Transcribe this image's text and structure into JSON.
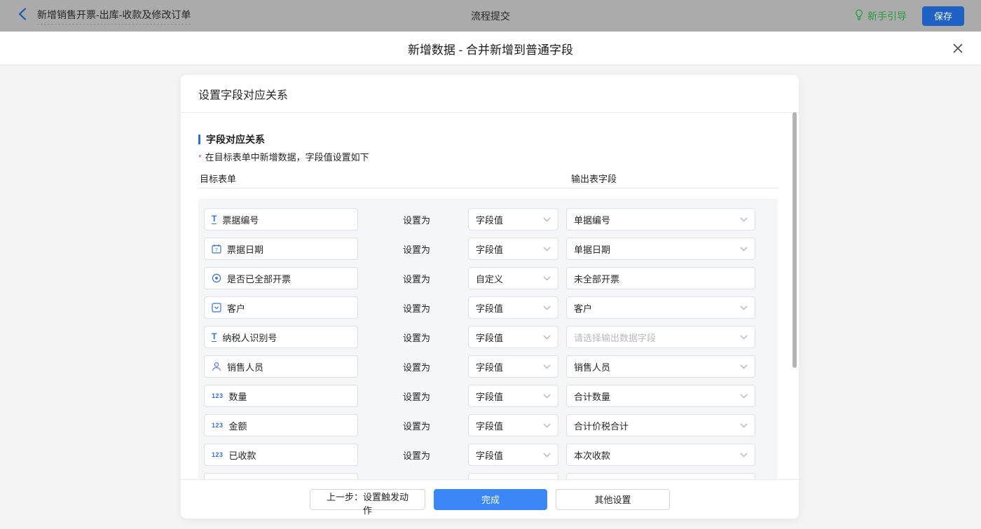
{
  "topbar": {
    "flow_title": "新增销售开票-出库-收款及修改订单",
    "center_title": "流程提交",
    "guide_label": "新手引导",
    "save_label": "保存"
  },
  "modal": {
    "title": "新增数据 - 合并新增到普通字段"
  },
  "panel": {
    "header": "设置字段对应关系",
    "section_title": "字段对应关系",
    "required_mark": "*",
    "hint": "在目标表单中新增数据，字段值设置如下",
    "col_left": "目标表单",
    "col_right": "输出表字段",
    "set_as_label": "设置为"
  },
  "rows": [
    {
      "icon": "text",
      "field": "票据编号",
      "mode": "字段值",
      "output_type": "select",
      "output": "单据编号"
    },
    {
      "icon": "date",
      "field": "票据日期",
      "mode": "字段值",
      "output_type": "select",
      "output": "单据日期"
    },
    {
      "icon": "radio",
      "field": "是否已全部开票",
      "mode": "自定义",
      "output_type": "text",
      "output": "未全部开票"
    },
    {
      "icon": "select",
      "field": "客户",
      "mode": "字段值",
      "output_type": "select",
      "output": "客户"
    },
    {
      "icon": "text",
      "field": "纳税人识别号",
      "mode": "字段值",
      "output_type": "select",
      "output": "",
      "placeholder": "请选择输出数据字段"
    },
    {
      "icon": "user",
      "field": "销售人员",
      "mode": "字段值",
      "output_type": "select",
      "output": "销售人员"
    },
    {
      "icon": "number",
      "field": "数量",
      "mode": "字段值",
      "output_type": "select",
      "output": "合计数量"
    },
    {
      "icon": "number",
      "field": "金额",
      "mode": "字段值",
      "output_type": "select",
      "output": "合计价税合计"
    },
    {
      "icon": "number",
      "field": "已收款",
      "mode": "字段值",
      "output_type": "select",
      "output": "本次收款"
    },
    {
      "partial": true,
      "icon": null,
      "field": "",
      "mode": "",
      "output_type": "select",
      "output": ""
    }
  ],
  "footer": {
    "prev_label": "上一步：设置触发动作",
    "done_label": "完成",
    "other_label": "其他设置"
  },
  "colors": {
    "topbar_bg": "#ababab",
    "save_button": "#1e60c4",
    "guide_green": "#279b40",
    "primary_blue": "#3b87f7",
    "field_icon_blue": "#3a6fd8",
    "section_bar_blue": "#2e6bd8",
    "required_red": "#e85151",
    "rows_bg": "#f5f6f7",
    "modal_bg": "#f4f4f5"
  }
}
